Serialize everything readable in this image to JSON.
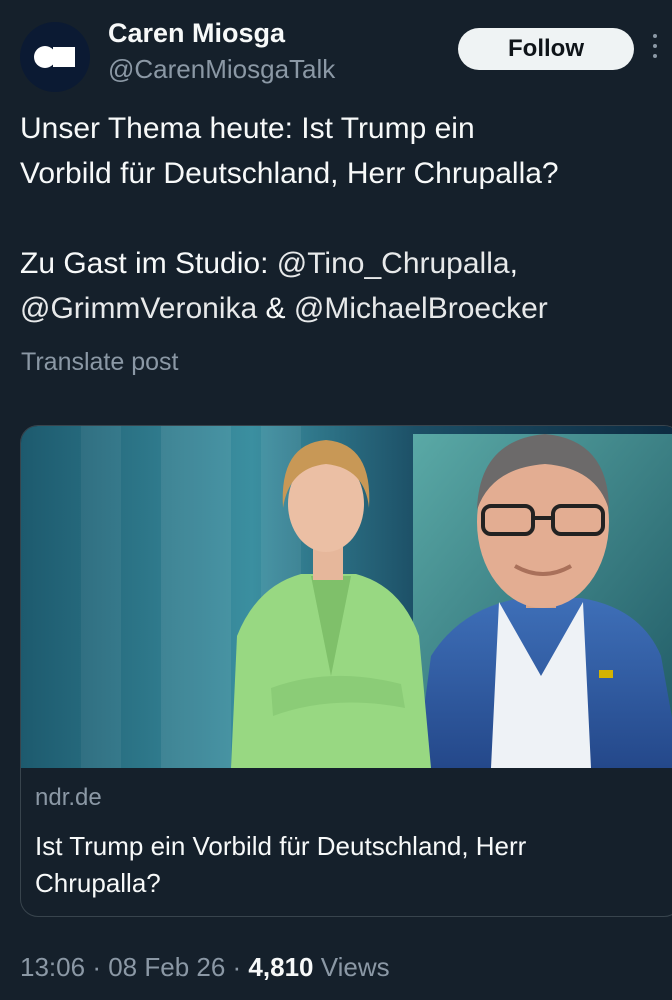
{
  "author": {
    "name": "Caren Miosga",
    "handle": "@CarenMiosgaTalk"
  },
  "follow_label": "Follow",
  "post": {
    "line1": "Unser Thema heute: Ist Trump ein",
    "line2": "Vorbild für Deutschland, Herr Chrupalla?",
    "line3_prefix": "Zu Gast im Studio: ",
    "mention1": "@Tino_Chrupalla",
    "line3_suffix": ",",
    "mention2": "@GrimmVeronika",
    "amp": " & ",
    "mention3": "@MichaelBroecker"
  },
  "translate_label": "Translate post",
  "card": {
    "domain": "ndr.de",
    "title": "Ist Trump ein Vorbild für Deutschland, Herr Chrupalla?"
  },
  "meta": {
    "time": "13:06",
    "date": "08 Feb 26",
    "views_count": "4,810",
    "views_label": "Views"
  },
  "icons": {
    "avatar": "talkshow-logo-icon",
    "more": "more-vertical-icon"
  }
}
